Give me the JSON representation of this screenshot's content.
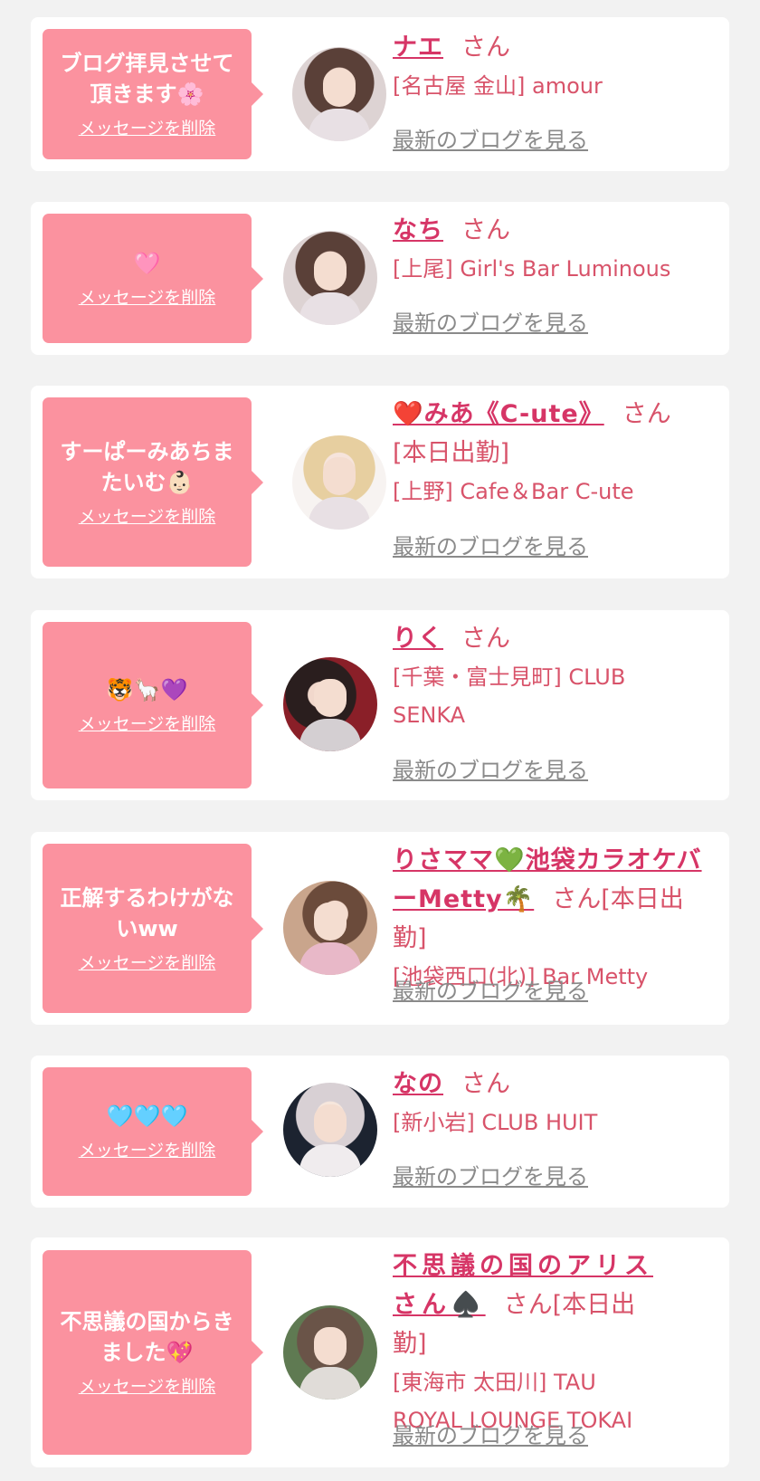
{
  "items": [
    {
      "message": "ブログ拝見させて頂きます🌸",
      "delete_label": "メッセージを削除",
      "name": "ナエ",
      "san": "さん",
      "shop": "[名古屋 金山] amour",
      "blog_label": "最新のブログを見る"
    },
    {
      "message": "🩷",
      "delete_label": "メッセージを削除",
      "name": "なち",
      "san": "さん",
      "shop": "[上尾] Girl's Bar Luminous",
      "blog_label": "最新のブログを見る"
    },
    {
      "message": "すーぱーみあちまたいむ👶🏻",
      "delete_label": "メッセージを削除",
      "name": "❤️みあ《C-ute》",
      "san": "さん[本日出勤]",
      "shop": "[上野] Cafe＆Bar C-ute",
      "blog_label": "最新のブログを見る"
    },
    {
      "message": "🐯🦙💜",
      "delete_label": "メッセージを削除",
      "name": "りく",
      "san": "さん",
      "shop": "[千葉・富士見町] CLUB SENKA",
      "blog_label": "最新のブログを見る"
    },
    {
      "message": "正解するわけがないww",
      "delete_label": "メッセージを削除",
      "name": "りさママ💚池袋カラオケバーMetty🌴",
      "san": "さん[本日出勤]",
      "shop": "[池袋西口(北)] Bar Metty",
      "blog_label": "最新のブログを見る"
    },
    {
      "message": "🩵🩵🩵",
      "delete_label": "メッセージを削除",
      "name": "なの",
      "san": "さん",
      "shop": "[新小岩] CLUB HUIT",
      "blog_label": "最新のブログを見る"
    },
    {
      "message": "不思議の国からきました💖",
      "delete_label": "メッセージを削除",
      "name": "不思議の国のアリスさん♠️",
      "san": "さん[本日出勤]",
      "shop": "[東海市 太田川] TAU ROYAL LOUNGE TOKAI",
      "blog_label": "最新のブログを見る"
    }
  ]
}
